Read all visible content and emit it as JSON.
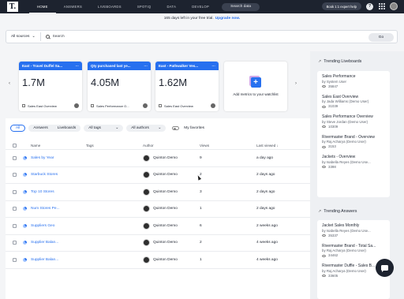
{
  "nav": {
    "logo": "T.",
    "items": [
      "HOME",
      "ANSWERS",
      "LIVEBOARDS",
      "SPOTIQ",
      "DATA",
      "DEVELOP"
    ],
    "search_label": "Search data",
    "expert_label": "Book 1:1 expert help",
    "help_label": "?"
  },
  "trial": {
    "text": "165 days left in your free trial.",
    "link": "Upgrade now."
  },
  "search": {
    "sources": "All sources",
    "placeholder": "Search",
    "go": "Go"
  },
  "watchlist": {
    "cards": [
      {
        "title": "East - Travel Duffel Sa...",
        "value": "1.7M",
        "source": "Sales East Overview"
      },
      {
        "title": "Qty purchased last ye...",
        "value": "4.05M",
        "source": "Sales Performance O..."
      },
      {
        "title": "East - Pathwalker Ves...",
        "value": "1.62M",
        "source": "Sales East Overview"
      }
    ],
    "add_label": "Add metrics to your watchlist"
  },
  "filters": {
    "all": "All",
    "answers": "Answers",
    "liveboards": "Liveboards",
    "tags": "All tags",
    "authors": "All authors",
    "favorites": "My favorites"
  },
  "table": {
    "headers": {
      "name": "Name",
      "tags": "Tags",
      "author": "Author",
      "views": "Views",
      "last": "Last viewed ↓"
    },
    "rows": [
      {
        "name": "Sales by Year",
        "author": "Quinton Demo",
        "views": "9",
        "last": "a day ago"
      },
      {
        "name": "Starbuck Stores",
        "author": "Quinton Demo",
        "views": "2",
        "last": "2 days ago"
      },
      {
        "name": "Top 10 Stores",
        "author": "Quinton Demo",
        "views": "3",
        "last": "2 days ago"
      },
      {
        "name": "Num Stores Pe...",
        "author": "Quinton Demo",
        "views": "1",
        "last": "2 days ago"
      },
      {
        "name": "Suppliers Geo",
        "author": "Quinton Demo",
        "views": "6",
        "last": "2 weeks ago"
      },
      {
        "name": "Supplier Balan...",
        "author": "Quinton Demo",
        "views": "2",
        "last": "4 weeks ago"
      },
      {
        "name": "Supplier Balan...",
        "author": "Quinton Demo",
        "views": "1",
        "last": "4 weeks ago"
      }
    ]
  },
  "trending_liveboards": {
    "title": "Trending Liveboards",
    "items": [
      {
        "title": "Sales Performance",
        "by": "by System User",
        "views": "35847"
      },
      {
        "title": "Sales East Overview",
        "by": "by Jada Williams (Demo User)",
        "views": "31039"
      },
      {
        "title": "Sales Performance Overview",
        "by": "by Steve Jordan (Demo User)",
        "views": "10309"
      },
      {
        "title": "Rivermaster Brand - Overview",
        "by": "by Raj Acharya (Demo User)",
        "views": "3153"
      },
      {
        "title": "Jackets - Overview",
        "by": "by Isabella Reyes (Demo Use...",
        "views": "3398"
      }
    ]
  },
  "trending_answers": {
    "title": "Trending Answers",
    "items": [
      {
        "title": "Jacket Sales Monthly",
        "by": "by Isabella Reyes (Demo Use...",
        "views": "35337"
      },
      {
        "title": "Rivermaster Brand - Total Sa...",
        "by": "by Raj Acharya (Demo User)",
        "views": "34462"
      },
      {
        "title": "Rivermaster Duffle - Sales B...",
        "by": "by Raj Acharya (Demo User)",
        "views": "33605"
      }
    ]
  }
}
